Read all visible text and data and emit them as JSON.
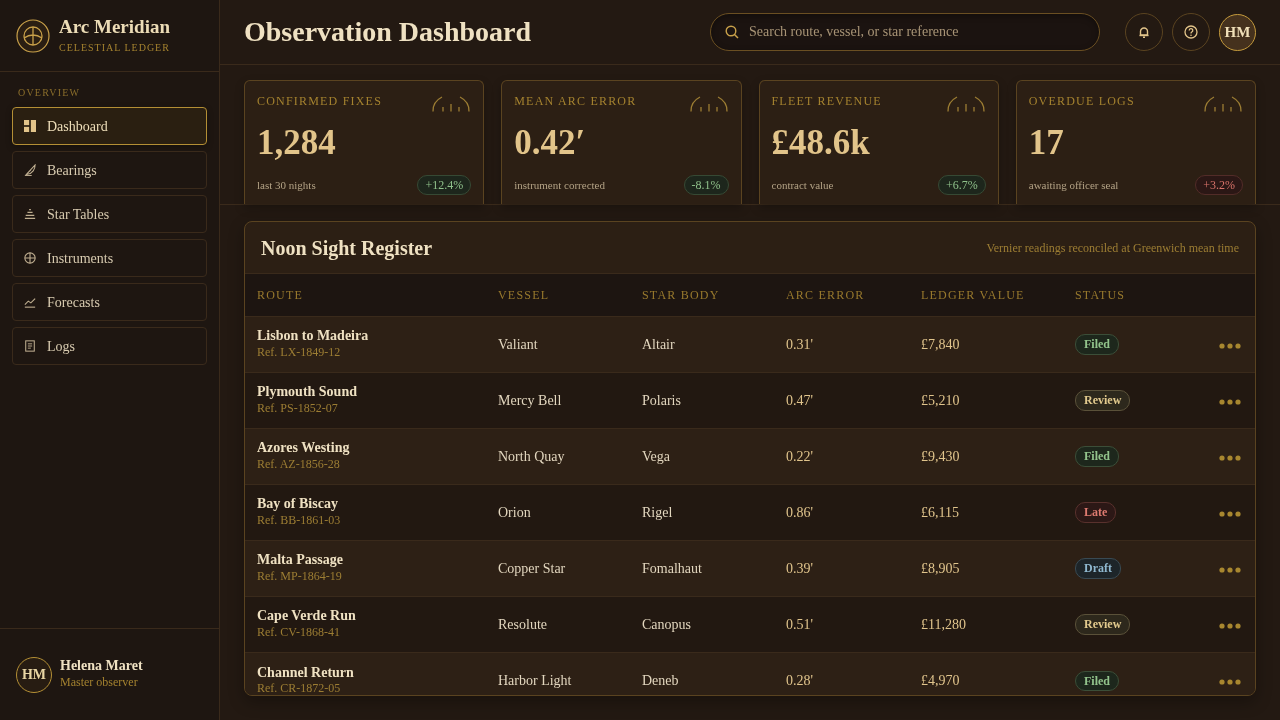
{
  "sidebar": {
    "brand": {
      "name": "Arc Meridian",
      "tagline": "CELESTIAL LEDGER"
    },
    "section_label": "OVERVIEW",
    "items": [
      {
        "label": "Dashboard",
        "selected": true
      },
      {
        "label": "Bearings",
        "selected": false
      },
      {
        "label": "Star Tables",
        "selected": false
      },
      {
        "label": "Instruments",
        "selected": false
      },
      {
        "label": "Forecasts",
        "selected": false
      },
      {
        "label": "Logs",
        "selected": false
      }
    ],
    "user": {
      "initials": "HM",
      "name": "Helena Maret",
      "role": "Master observer"
    }
  },
  "header": {
    "title": "Observation Dashboard",
    "search": {
      "placeholder": "Search route, vessel, or star reference"
    },
    "avatar": "HM"
  },
  "stats": [
    {
      "label": "CONFIRMED FIXES",
      "value": "1,284",
      "note": "last 30 nights",
      "delta": "+12.4%",
      "color": "#8fc08a"
    },
    {
      "label": "MEAN ARC ERROR",
      "value": "0.42′",
      "note": "instrument corrected",
      "delta": "-8.1%",
      "color": "#8fc08a"
    },
    {
      "label": "FLEET REVENUE",
      "value": "£48.6k",
      "note": "contract value",
      "delta": "+6.7%",
      "color": "#8fc08a"
    },
    {
      "label": "OVERDUE LOGS",
      "value": "17",
      "note": "awaiting officer seal",
      "delta": "+3.2%",
      "color": "#d9736a"
    }
  ],
  "register": {
    "title": "Noon Sight Register",
    "note": "Vernier readings reconciled at Greenwich mean time",
    "columns": [
      "ROUTE",
      "VESSEL",
      "STAR BODY",
      "ARC ERROR",
      "LEDGER VALUE",
      "STATUS"
    ],
    "rows": [
      {
        "route": "Lisbon to Madeira",
        "ref": "Ref. LX-1849-12",
        "vessel": "Valiant",
        "star": "Altair",
        "arc_error": "0.31'",
        "ledger_value": "£7,840",
        "status": {
          "label": "Filed",
          "color": "#93c48c"
        }
      },
      {
        "route": "Plymouth Sound",
        "ref": "Ref. PS-1852-07",
        "vessel": "Mercy Bell",
        "star": "Polaris",
        "arc_error": "0.47'",
        "ledger_value": "£5,210",
        "status": {
          "label": "Review",
          "color": "#e2ca8e"
        }
      },
      {
        "route": "Azores Westing",
        "ref": "Ref. AZ-1856-28",
        "vessel": "North Quay",
        "star": "Vega",
        "arc_error": "0.22'",
        "ledger_value": "£9,430",
        "status": {
          "label": "Filed",
          "color": "#93c48c"
        }
      },
      {
        "route": "Bay of Biscay",
        "ref": "Ref. BB-1861-03",
        "vessel": "Orion",
        "star": "Rigel",
        "arc_error": "0.86'",
        "ledger_value": "£6,115",
        "status": {
          "label": "Late",
          "color": "#de7a70"
        }
      },
      {
        "route": "Malta Passage",
        "ref": "Ref. MP-1864-19",
        "vessel": "Copper Star",
        "star": "Fomalhaut",
        "arc_error": "0.39'",
        "ledger_value": "£8,905",
        "status": {
          "label": "Draft",
          "color": "#8fb8cf"
        }
      },
      {
        "route": "Cape Verde Run",
        "ref": "Ref. CV-1868-41",
        "vessel": "Resolute",
        "star": "Canopus",
        "arc_error": "0.51'",
        "ledger_value": "£11,280",
        "status": {
          "label": "Review",
          "color": "#e2ca8e"
        }
      },
      {
        "route": "Channel Return",
        "ref": "Ref. CR-1872-05",
        "vessel": "Harbor Light",
        "star": "Deneb",
        "arc_error": "0.28'",
        "ledger_value": "£4,970",
        "status": {
          "label": "Filed",
          "color": "#93c48c"
        }
      }
    ]
  }
}
